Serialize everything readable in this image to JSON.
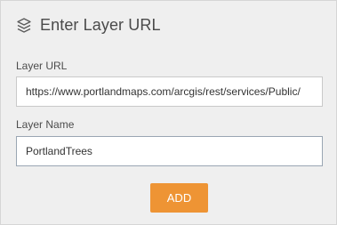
{
  "dialog": {
    "title": "Enter Layer URL",
    "title_icon": "layers-icon"
  },
  "url_field": {
    "label": "Layer URL",
    "value": "https://www.portlandmaps.com/arcgis/rest/services/Public/"
  },
  "name_field": {
    "label": "Layer Name",
    "value": "PortlandTrees"
  },
  "actions": {
    "add_label": "ADD"
  },
  "colors": {
    "panel_bg": "#efefef",
    "accent_button": "#ee9434"
  }
}
